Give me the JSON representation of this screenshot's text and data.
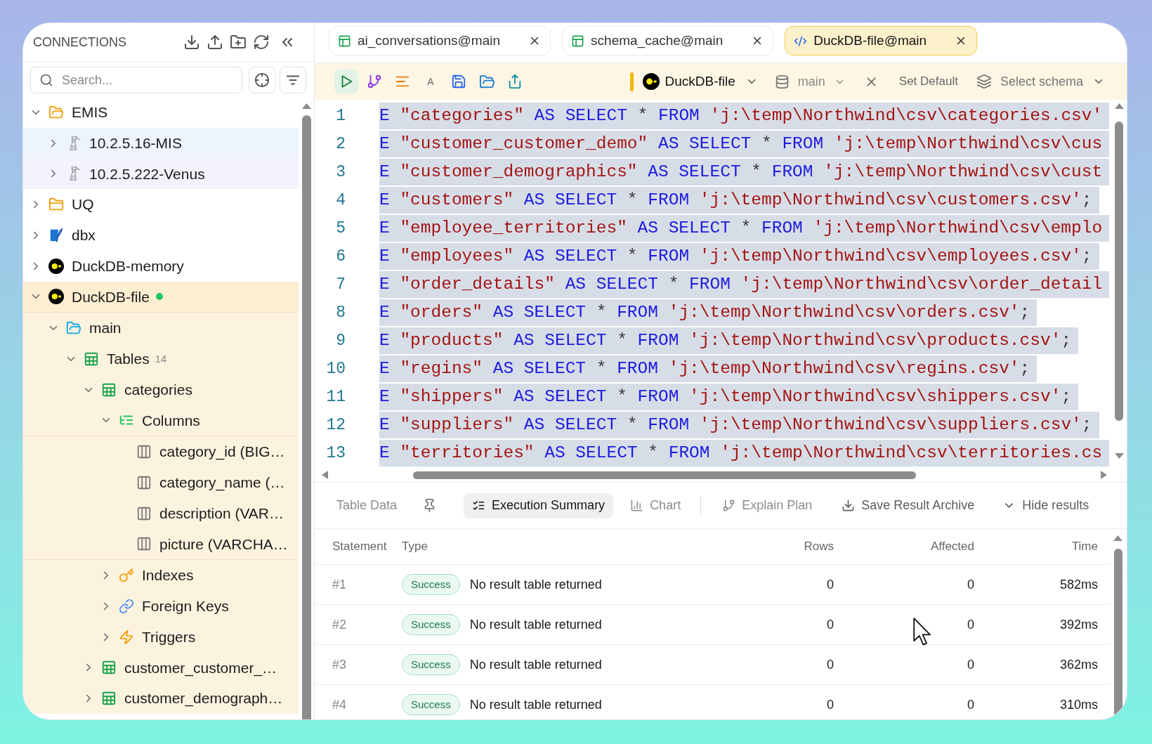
{
  "sidebar": {
    "title": "CONNECTIONS",
    "search": {
      "placeholder": "Search..."
    },
    "tree": [
      {
        "kind": "folder",
        "label": "EMIS",
        "expanded": true,
        "children": [
          {
            "kind": "server",
            "label": "10.2.5.16-MIS",
            "expanded": false,
            "color": "#eef4fe"
          },
          {
            "kind": "server",
            "label": "10.2.5.222-Venus",
            "expanded": false,
            "color": "#f5f1fd"
          }
        ]
      },
      {
        "kind": "folder",
        "label": "UQ",
        "expanded": false
      },
      {
        "kind": "sqlite",
        "label": "dbx",
        "expanded": false
      },
      {
        "kind": "duckdb",
        "label": "DuckDB-memory",
        "expanded": false
      },
      {
        "kind": "duckdb",
        "label": "DuckDB-file",
        "expanded": true,
        "connected": true,
        "color": "#fbeed1",
        "children": [
          {
            "kind": "schema",
            "label": "main",
            "expanded": true,
            "children": [
              {
                "kind": "tables",
                "label": "Tables",
                "count": "14",
                "expanded": true,
                "children": [
                  {
                    "kind": "table",
                    "label": "categories",
                    "expanded": true,
                    "children": [
                      {
                        "kind": "columns",
                        "label": "Columns",
                        "expanded": true,
                        "children": [
                          {
                            "kind": "column",
                            "label": "category_id (BIG…"
                          },
                          {
                            "kind": "column",
                            "label": "category_name (…"
                          },
                          {
                            "kind": "column",
                            "label": "description (VAR…"
                          },
                          {
                            "kind": "column",
                            "label": "picture (VARCHA…"
                          }
                        ]
                      },
                      {
                        "kind": "indexes",
                        "label": "Indexes",
                        "expanded": false
                      },
                      {
                        "kind": "foreign_keys",
                        "label": "Foreign Keys",
                        "expanded": false
                      },
                      {
                        "kind": "triggers",
                        "label": "Triggers",
                        "expanded": false
                      }
                    ]
                  },
                  {
                    "kind": "table",
                    "label": "customer_customer_…",
                    "expanded": false
                  },
                  {
                    "kind": "table",
                    "label": "customer_demograph…",
                    "expanded": false
                  }
                ]
              }
            ]
          }
        ]
      }
    ]
  },
  "tabs": [
    {
      "kind": "table",
      "label": "ai_conversations@main",
      "selected": false
    },
    {
      "kind": "table",
      "label": "schema_cache@main",
      "selected": false
    },
    {
      "kind": "query",
      "label": "DuckDB-file@main",
      "selected": true
    }
  ],
  "toolbar": {
    "font_button": "A",
    "connection": {
      "label": "DuckDB-file",
      "color": "#f2b705"
    },
    "database": {
      "label": "main"
    },
    "set_default": "Set Default",
    "schema": {
      "label": "Select schema"
    }
  },
  "editor": {
    "lines": [
      {
        "number": "1",
        "selected": true,
        "tokens": [
          {
            "kind": "keyword",
            "text": "E"
          },
          {
            "kind": "string",
            "text": " \"categories\""
          },
          {
            "kind": "keyword",
            "text": " AS SELECT"
          },
          {
            "kind": "plain",
            "text": " *"
          },
          {
            "kind": "keyword",
            "text": " FROM"
          },
          {
            "kind": "string",
            "text": " 'j:\\temp\\Northwind\\csv\\categories.csv'"
          }
        ]
      },
      {
        "number": "2",
        "selected": true,
        "tokens": [
          {
            "kind": "keyword",
            "text": "E"
          },
          {
            "kind": "string",
            "text": " \"customer_customer_demo\""
          },
          {
            "kind": "keyword",
            "text": " AS SELECT"
          },
          {
            "kind": "plain",
            "text": " *"
          },
          {
            "kind": "keyword",
            "text": " FROM"
          },
          {
            "kind": "string",
            "text": " 'j:\\temp\\Northwind\\csv\\cus"
          }
        ]
      },
      {
        "number": "3",
        "selected": true,
        "tokens": [
          {
            "kind": "keyword",
            "text": "E"
          },
          {
            "kind": "string",
            "text": " \"customer_demographics\""
          },
          {
            "kind": "keyword",
            "text": " AS SELECT"
          },
          {
            "kind": "plain",
            "text": " *"
          },
          {
            "kind": "keyword",
            "text": " FROM"
          },
          {
            "kind": "string",
            "text": " 'j:\\temp\\Northwind\\csv\\cust"
          }
        ]
      },
      {
        "number": "4",
        "selected": true,
        "tokens": [
          {
            "kind": "keyword",
            "text": "E"
          },
          {
            "kind": "string",
            "text": " \"customers\""
          },
          {
            "kind": "keyword",
            "text": " AS SELECT"
          },
          {
            "kind": "plain",
            "text": " *"
          },
          {
            "kind": "keyword",
            "text": " FROM"
          },
          {
            "kind": "string",
            "text": " 'j:\\temp\\Northwind\\csv\\customers.csv'"
          },
          {
            "kind": "plain",
            "text": ";"
          }
        ]
      },
      {
        "number": "5",
        "selected": true,
        "tokens": [
          {
            "kind": "keyword",
            "text": "E"
          },
          {
            "kind": "string",
            "text": " \"employee_territories\""
          },
          {
            "kind": "keyword",
            "text": " AS SELECT"
          },
          {
            "kind": "plain",
            "text": " *"
          },
          {
            "kind": "keyword",
            "text": " FROM"
          },
          {
            "kind": "string",
            "text": " 'j:\\temp\\Northwind\\csv\\emplo"
          }
        ]
      },
      {
        "number": "6",
        "selected": true,
        "tokens": [
          {
            "kind": "keyword",
            "text": "E"
          },
          {
            "kind": "string",
            "text": " \"employees\""
          },
          {
            "kind": "keyword",
            "text": " AS SELECT"
          },
          {
            "kind": "plain",
            "text": " *"
          },
          {
            "kind": "keyword",
            "text": " FROM"
          },
          {
            "kind": "string",
            "text": " 'j:\\temp\\Northwind\\csv\\employees.csv'"
          },
          {
            "kind": "plain",
            "text": ";"
          }
        ]
      },
      {
        "number": "7",
        "selected": true,
        "tokens": [
          {
            "kind": "keyword",
            "text": "E"
          },
          {
            "kind": "string",
            "text": " \"order_details\""
          },
          {
            "kind": "keyword",
            "text": " AS SELECT"
          },
          {
            "kind": "plain",
            "text": " *"
          },
          {
            "kind": "keyword",
            "text": " FROM"
          },
          {
            "kind": "string",
            "text": " 'j:\\temp\\Northwind\\csv\\order_detail"
          }
        ]
      },
      {
        "number": "8",
        "selected": true,
        "tokens": [
          {
            "kind": "keyword",
            "text": "E"
          },
          {
            "kind": "string",
            "text": " \"orders\""
          },
          {
            "kind": "keyword",
            "text": " AS SELECT"
          },
          {
            "kind": "plain",
            "text": " *"
          },
          {
            "kind": "keyword",
            "text": " FROM"
          },
          {
            "kind": "string",
            "text": " 'j:\\temp\\Northwind\\csv\\orders.csv'"
          },
          {
            "kind": "plain",
            "text": ";"
          }
        ]
      },
      {
        "number": "9",
        "selected": true,
        "tokens": [
          {
            "kind": "keyword",
            "text": "E"
          },
          {
            "kind": "string",
            "text": " \"products\""
          },
          {
            "kind": "keyword",
            "text": " AS SELECT"
          },
          {
            "kind": "plain",
            "text": " *"
          },
          {
            "kind": "keyword",
            "text": " FROM"
          },
          {
            "kind": "string",
            "text": " 'j:\\temp\\Northwind\\csv\\products.csv'"
          },
          {
            "kind": "plain",
            "text": ";"
          }
        ]
      },
      {
        "number": "10",
        "selected": true,
        "tokens": [
          {
            "kind": "keyword",
            "text": "E"
          },
          {
            "kind": "string",
            "text": " \"regins\""
          },
          {
            "kind": "keyword",
            "text": " AS SELECT"
          },
          {
            "kind": "plain",
            "text": " *"
          },
          {
            "kind": "keyword",
            "text": " FROM"
          },
          {
            "kind": "string",
            "text": " 'j:\\temp\\Northwind\\csv\\regins.csv'"
          },
          {
            "kind": "plain",
            "text": ";"
          }
        ]
      },
      {
        "number": "11",
        "selected": true,
        "tokens": [
          {
            "kind": "keyword",
            "text": "E"
          },
          {
            "kind": "string",
            "text": " \"shippers\""
          },
          {
            "kind": "keyword",
            "text": " AS SELECT"
          },
          {
            "kind": "plain",
            "text": " *"
          },
          {
            "kind": "keyword",
            "text": " FROM"
          },
          {
            "kind": "string",
            "text": " 'j:\\temp\\Northwind\\csv\\shippers.csv'"
          },
          {
            "kind": "plain",
            "text": ";"
          }
        ]
      },
      {
        "number": "12",
        "selected": true,
        "tokens": [
          {
            "kind": "keyword",
            "text": "E"
          },
          {
            "kind": "string",
            "text": " \"suppliers\""
          },
          {
            "kind": "keyword",
            "text": " AS SELECT"
          },
          {
            "kind": "plain",
            "text": " *"
          },
          {
            "kind": "keyword",
            "text": " FROM"
          },
          {
            "kind": "string",
            "text": " 'j:\\temp\\Northwind\\csv\\suppliers.csv'"
          },
          {
            "kind": "plain",
            "text": ";"
          }
        ]
      },
      {
        "number": "13",
        "selected": true,
        "tokens": [
          {
            "kind": "keyword",
            "text": "E"
          },
          {
            "kind": "string",
            "text": " \"territories\""
          },
          {
            "kind": "keyword",
            "text": " AS SELECT"
          },
          {
            "kind": "plain",
            "text": " *"
          },
          {
            "kind": "keyword",
            "text": " FROM"
          },
          {
            "kind": "string",
            "text": " 'j:\\temp\\Northwind\\csv\\territories.cs"
          }
        ]
      }
    ]
  },
  "results": {
    "tabs": [
      {
        "kind": "table_data",
        "label": "Table Data",
        "selected": false
      },
      {
        "kind": "summary",
        "label": "Execution Summary",
        "selected": true
      },
      {
        "kind": "chart",
        "label": "Chart",
        "selected": false
      },
      {
        "kind": "explain",
        "label": "Explain Plan",
        "selected": false
      }
    ],
    "actions": [
      {
        "kind": "save",
        "label": "Save Result Archive"
      },
      {
        "kind": "hide",
        "label": "Hide results"
      }
    ],
    "table": {
      "columns": [
        "Statement",
        "Type",
        "Rows",
        "Affected",
        "Time"
      ],
      "rows": [
        {
          "statement": "#1",
          "status": "Success",
          "message": "No result table returned",
          "rows": "0",
          "affected": "0",
          "time": "582ms"
        },
        {
          "statement": "#2",
          "status": "Success",
          "message": "No result table returned",
          "rows": "0",
          "affected": "0",
          "time": "392ms"
        },
        {
          "statement": "#3",
          "status": "Success",
          "message": "No result table returned",
          "rows": "0",
          "affected": "0",
          "time": "362ms"
        },
        {
          "statement": "#4",
          "status": "Success",
          "message": "No result table returned",
          "rows": "0",
          "affected": "0",
          "time": "310ms"
        }
      ]
    }
  }
}
